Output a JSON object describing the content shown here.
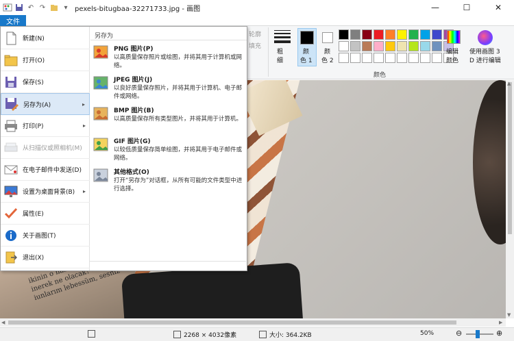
{
  "window": {
    "title": "pexels-bitugbaa-32271733.jpg - 画图",
    "minimize_icon": "minimize-icon",
    "maximize_icon": "maximize-icon",
    "close_icon": "close-icon"
  },
  "ribbon": {
    "file_tab": "文件",
    "faded_outline": "轮廓",
    "faded_fill": "填充",
    "stroke_label_1": "粗",
    "stroke_label_2": "细",
    "color1_label_1": "颜",
    "color1_label_2": "色 1",
    "color2_label_1": "颜",
    "color2_label_2": "色 2",
    "edit_colors_1": "编辑",
    "edit_colors_2": "颜色",
    "paint3d_1": "使用画图 3",
    "paint3d_2": "D 进行编辑",
    "colors_group": "颜色",
    "palette_row1": [
      "#000000",
      "#7f7f7f",
      "#880015",
      "#ed1c24",
      "#ff7f27",
      "#fff200",
      "#22b14c",
      "#00a2e8",
      "#3f48cc",
      "#a349a4"
    ],
    "palette_row2": [
      "#ffffff",
      "#c3c3c3",
      "#b97a57",
      "#ffaec9",
      "#ffc90e",
      "#efe4b0",
      "#b5e61d",
      "#99d9ea",
      "#7092be",
      "#c8bfe7"
    ],
    "palette_row3": [
      "#ffffff",
      "#ffffff",
      "#ffffff",
      "#ffffff",
      "#ffffff",
      "#ffffff",
      "#ffffff",
      "#ffffff",
      "#ffffff",
      "#ffffff"
    ],
    "color1": "#000000",
    "color2": "#ffffff"
  },
  "file_menu": {
    "items": [
      {
        "label": "新建(N)",
        "icon": "new-document-icon"
      },
      {
        "label": "打开(O)",
        "icon": "open-folder-icon"
      },
      {
        "label": "保存(S)",
        "icon": "save-floppy-icon"
      },
      {
        "label": "另存为(A)",
        "icon": "save-as-icon"
      },
      {
        "label": "打印(P)",
        "icon": "printer-icon"
      },
      {
        "label": "从扫描仪或照相机(M)",
        "icon": "scanner-icon"
      },
      {
        "label": "在电子邮件中发送(D)",
        "icon": "email-icon"
      },
      {
        "label": "设置为桌面背景(B)",
        "icon": "desktop-background-icon"
      },
      {
        "label": "属性(E)",
        "icon": "properties-checkmark-icon"
      },
      {
        "label": "关于画图(T)",
        "icon": "info-icon"
      },
      {
        "label": "退出(X)",
        "icon": "exit-icon"
      }
    ],
    "saveas_heading": "另存为",
    "formats": [
      {
        "name": "PNG 图片(P)",
        "desc": "以高质量保存照片或绘图，并将其用于计算机或网络。",
        "icon": "png-file-icon"
      },
      {
        "name": "JPEG 图片(J)",
        "desc": "以良好质量保存照片，并将其用于计算机、电子邮件或网络。",
        "icon": "jpeg-file-icon"
      },
      {
        "name": "BMP 图片(B)",
        "desc": "以高质量保存所有类型图片，并将其用于计算机。",
        "icon": "bmp-file-icon"
      },
      {
        "name": "GIF 图片(G)",
        "desc": "以较低质量保存简单绘图，并将其用于电子邮件或网络。",
        "icon": "gif-file-icon"
      },
      {
        "name": "其他格式(O)",
        "desc": "打开“另存为”对话框，从所有可能的文件类型中进行选择。",
        "icon": "other-formats-icon"
      }
    ]
  },
  "canvas_text": {
    "line1": "ikinin o haber sizi",
    "line2": "inerek ne olacak? »",
    "line3": "iunlarım lebessüm, sesniz"
  },
  "statusbar": {
    "dimensions": "2268 × 4032像素",
    "size": "大小: 364.2KB",
    "zoom": "50%"
  }
}
